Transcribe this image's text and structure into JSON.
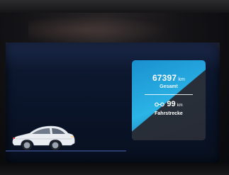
{
  "trip_panel": {
    "total_value": "67397",
    "total_unit": "km",
    "total_label": "Gesamt",
    "range_value": "99",
    "range_unit": "km",
    "range_label": "Fahrstrecke",
    "range_icon": "trip-distance-icon"
  },
  "car_image": "vehicle-side-silhouette",
  "colors": {
    "panel_blue": "#2bb4e6",
    "screen_bg": "#0a1429",
    "text": "#ffffff"
  }
}
